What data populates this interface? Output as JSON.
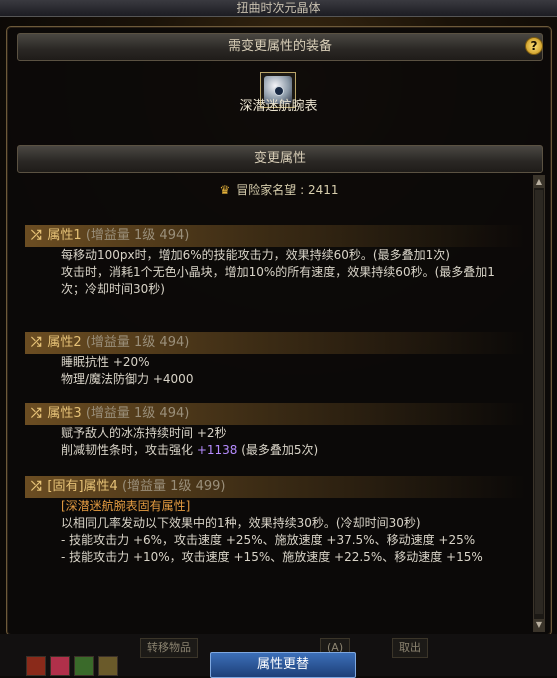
{
  "window_title": "扭曲时次元晶体",
  "help_label": "?",
  "equip_section": "需变更属性的装备",
  "item": {
    "name": "深潜迷航腕表",
    "icon": "wristwatch-icon"
  },
  "change_section": "变更属性",
  "fame": {
    "label": "冒险家名望",
    "value": "2411",
    "icon": "crest-icon"
  },
  "attributes": [
    {
      "name": "属性1",
      "gain": "(增益量 1级 494)",
      "lines": [
        "每移动100px时，增加6%的技能攻击力，效果持续60秒。(最多叠加1次)",
        "攻击时，消耗1个无色小晶块，增加10%的所有速度，效果持续60秒。(最多叠加1次；冷却时间30秒)"
      ]
    },
    {
      "name": "属性2",
      "gain": "(增益量 1级 494)",
      "lines": [
        "睡眠抗性 +20%",
        "物理/魔法防御力 +4000"
      ]
    },
    {
      "name": "属性3",
      "gain": "(增益量 1级 494)",
      "lines": [
        "赋予敌人的冰冻持续时间 +2秒"
      ],
      "line_mixed": {
        "before": "削减韧性条时，攻击强化 ",
        "highlight": "+1138",
        "after": " (最多叠加5次)"
      }
    },
    {
      "name": "[固有]属性4",
      "gain": "(增益量 1级 499)",
      "tag": "[深潜迷航腕表固有属性]",
      "lines": [
        "以相同几率发动以下效果中的1种，效果持续30秒。(冷却时间30秒)",
        "- 技能攻击力 +6%，攻击速度 +25%、施放速度 +37.5%、移动速度 +25%",
        "- 技能攻击力 +10%，攻击速度 +15%、施放速度 +22.5%、移动速度 +15%"
      ]
    }
  ],
  "bottom": {
    "buttons": [
      "转移物品",
      "(A)",
      "取出"
    ],
    "confirm": "属性更替"
  }
}
